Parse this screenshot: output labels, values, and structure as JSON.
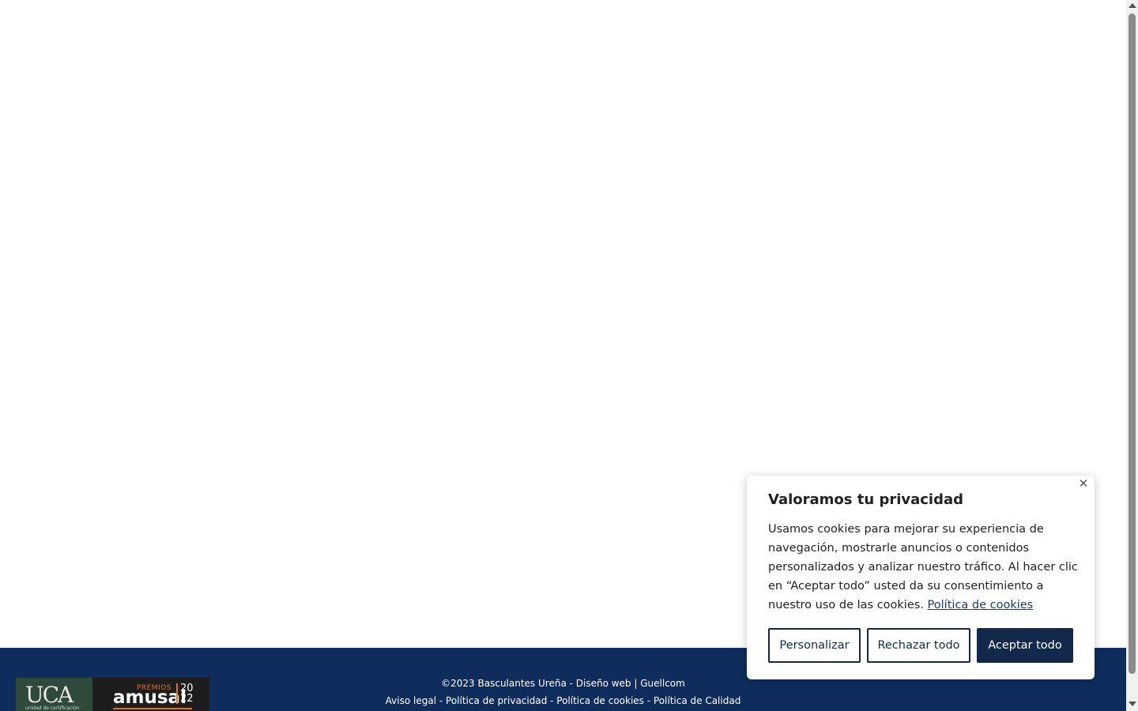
{
  "footer": {
    "logos": {
      "uca": {
        "mark": "UCA",
        "sub": "unidad de certificación"
      },
      "amusal": {
        "premios": "PREMIOS",
        "name": "amusal",
        "year": "2022"
      }
    },
    "copyright": "©2023 Basculantes Ureña",
    "separator": " - ",
    "design_label": "Diseño web",
    "pipe": " | ",
    "design_company": "Guellcom",
    "links": {
      "aviso_legal": "Aviso legal",
      "privacidad": "Política de privacidad",
      "cookies": "Política de cookies",
      "calidad": "Política de Calidad"
    },
    "colors": {
      "background": "#0f2d5c"
    }
  },
  "cookie_banner": {
    "title": "Valoramos tu privacidad",
    "body": "Usamos cookies para mejorar su experiencia de navegación, mostrarle anuncios o contenidos personalizados y analizar nuestro tráfico. Al hacer clic en “Aceptar todo” usted da su consentimiento a nuestro uso de las cookies.",
    "link": "Política de cookies",
    "close_icon": "close-icon",
    "buttons": {
      "personalizar": "Personalizar",
      "rechazar": "Rechazar todo",
      "aceptar": "Aceptar todo"
    },
    "colors": {
      "primary": "#13294b"
    }
  }
}
